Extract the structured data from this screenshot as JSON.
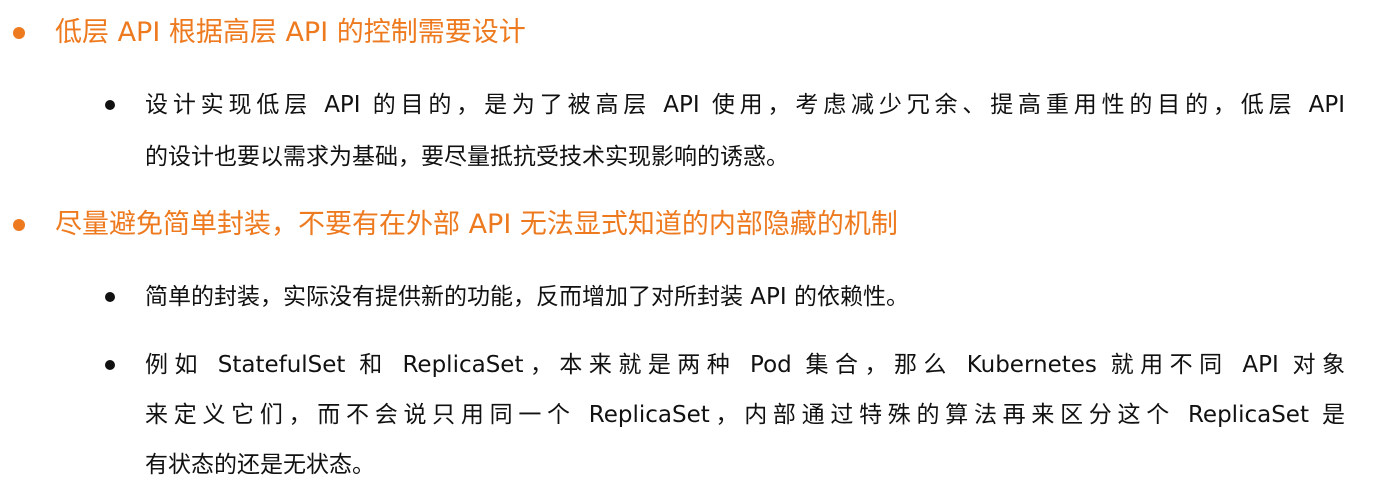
{
  "items": [
    {
      "heading": "低层 API 根据高层 API 的控制需要设计",
      "subs": [
        {
          "lines": [
            "设计实现低层 API 的目的，是为了被高层 API 使用，考虑减少冗余、提高重用性的目的，低层 API",
            "的设计也要以需求为基础，要尽量抵抗受技术实现影响的诱惑。"
          ]
        }
      ]
    },
    {
      "heading": "尽量避免简单封装，不要有在外部 API 无法显式知道的内部隐藏的机制",
      "subs": [
        {
          "lines": [
            "简单的封装，实际没有提供新的功能，反而增加了对所封装 API 的依赖性。"
          ]
        },
        {
          "lines": [
            "例如 StatefulSet 和 ReplicaSet，本来就是两种 Pod 集合，那么 Kubernetes 就用不同 API 对象",
            "来定义它们，而不会说只用同一个 ReplicaSet，内部通过特殊的算法再来区分这个 ReplicaSet 是",
            "有状态的还是无状态。"
          ]
        }
      ]
    }
  ],
  "colors": {
    "accent": "#ee7a1f",
    "text": "#111111"
  }
}
